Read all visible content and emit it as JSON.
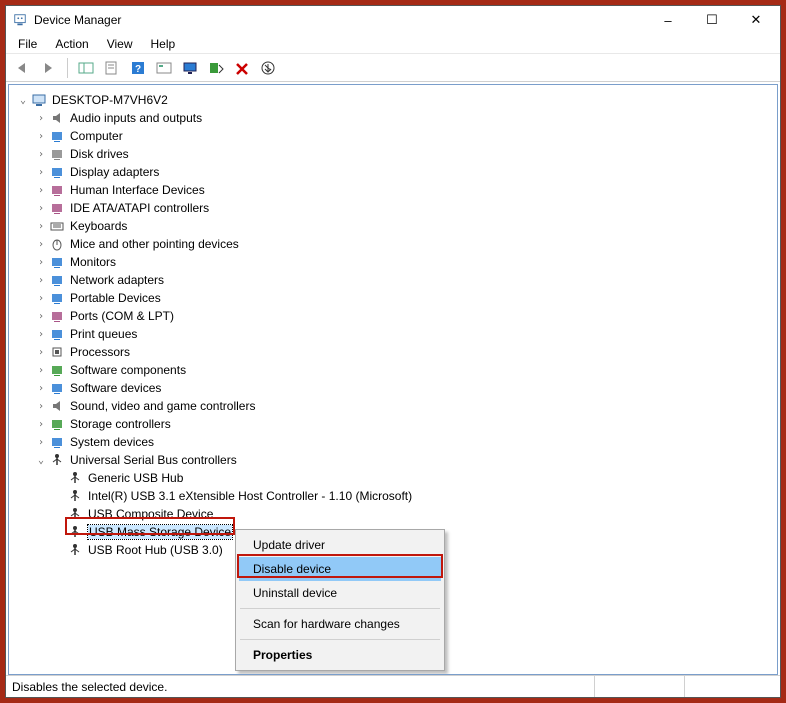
{
  "window": {
    "title": "Device Manager",
    "controls": {
      "min": "–",
      "max": "☐",
      "close": "✕"
    }
  },
  "menubar": [
    "File",
    "Action",
    "View",
    "Help"
  ],
  "toolbar_icons": [
    "back-icon",
    "forward-icon",
    "sep",
    "show-hide-tree-icon",
    "properties-icon",
    "help-icon",
    "console-tree-icon",
    "monitor-icon",
    "scan-icon",
    "delete-icon",
    "update-icon"
  ],
  "tree": {
    "root": {
      "label": "DESKTOP-M7VH6V2",
      "expanded": true
    },
    "categories": [
      {
        "label": "Audio inputs and outputs",
        "icon": "audio"
      },
      {
        "label": "Computer",
        "icon": "computer"
      },
      {
        "label": "Disk drives",
        "icon": "disk"
      },
      {
        "label": "Display adapters",
        "icon": "display"
      },
      {
        "label": "Human Interface Devices",
        "icon": "hid"
      },
      {
        "label": "IDE ATA/ATAPI controllers",
        "icon": "ide"
      },
      {
        "label": "Keyboards",
        "icon": "keyboard"
      },
      {
        "label": "Mice and other pointing devices",
        "icon": "mouse"
      },
      {
        "label": "Monitors",
        "icon": "monitor"
      },
      {
        "label": "Network adapters",
        "icon": "network"
      },
      {
        "label": "Portable Devices",
        "icon": "portable"
      },
      {
        "label": "Ports (COM & LPT)",
        "icon": "ports"
      },
      {
        "label": "Print queues",
        "icon": "print"
      },
      {
        "label": "Processors",
        "icon": "cpu"
      },
      {
        "label": "Software components",
        "icon": "swcomp"
      },
      {
        "label": "Software devices",
        "icon": "swdev"
      },
      {
        "label": "Sound, video and game controllers",
        "icon": "sound"
      },
      {
        "label": "Storage controllers",
        "icon": "storage"
      },
      {
        "label": "System devices",
        "icon": "system"
      }
    ],
    "usb": {
      "label": "Universal Serial Bus controllers",
      "icon": "usb",
      "expanded": true,
      "children": [
        {
          "label": "Generic USB Hub"
        },
        {
          "label": "Intel(R) USB 3.1 eXtensible Host Controller - 1.10 (Microsoft)"
        },
        {
          "label": "USB Composite Device"
        },
        {
          "label": "USB Mass Storage Device",
          "selected": true,
          "highlighted": true
        },
        {
          "label": "USB Root Hub (USB 3.0)"
        }
      ]
    }
  },
  "context_menu": {
    "items": [
      {
        "label": "Update driver"
      },
      {
        "label": "Disable device",
        "highlight": true,
        "red_box": true
      },
      {
        "label": "Uninstall device"
      },
      {
        "sep": true
      },
      {
        "label": "Scan for hardware changes"
      },
      {
        "sep": true
      },
      {
        "label": "Properties",
        "bold": true
      }
    ]
  },
  "statusbar": {
    "text": "Disables the selected device."
  }
}
